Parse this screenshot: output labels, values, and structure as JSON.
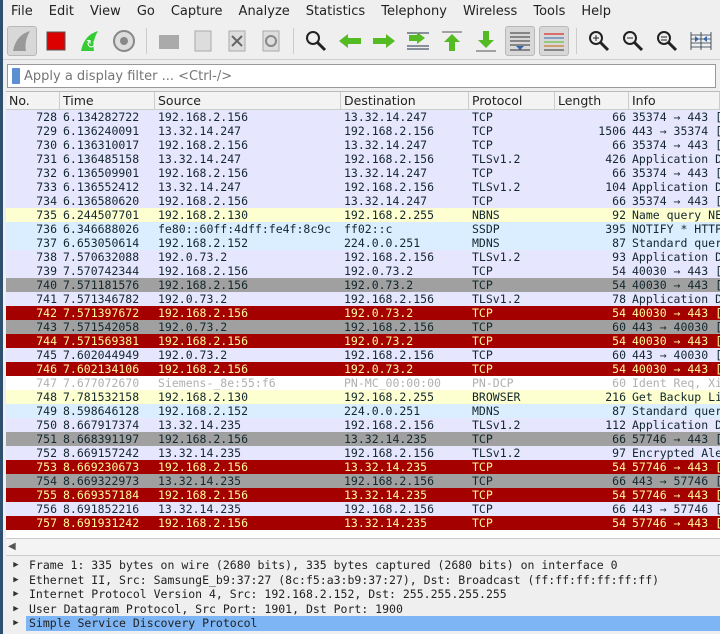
{
  "menu": [
    "File",
    "Edit",
    "View",
    "Go",
    "Capture",
    "Analyze",
    "Statistics",
    "Telephony",
    "Wireless",
    "Tools",
    "Help"
  ],
  "toolbar": [
    "start-capture",
    "stop-capture",
    "restart-capture",
    "capture-options",
    "open-file",
    "save-file",
    "close-file",
    "reload-file",
    "find-packet",
    "go-back",
    "go-forward",
    "go-to-packet",
    "go-first",
    "go-last",
    "auto-scroll",
    "colorize",
    "zoom-in",
    "zoom-out",
    "zoom-normal",
    "resize-columns"
  ],
  "filter": {
    "placeholder": "Apply a display filter ... <Ctrl-/>",
    "value": ""
  },
  "columns": [
    "No.",
    "Time",
    "Source",
    "Destination",
    "Protocol",
    "Length",
    "Info"
  ],
  "colors": {
    "tcp": "#e7e6ff",
    "bad_tcp": "#a40000",
    "bad_text": "#fffc9c",
    "grey": "#a0a0a0",
    "nbns": "#feffd0",
    "udp": "#daeeff",
    "selected": "#7eb5f5"
  },
  "packets": [
    [
      "728",
      "6.134282722",
      "192.168.2.156",
      "13.32.14.247",
      "TCP",
      "66",
      "35374 → 443 [",
      "tcp"
    ],
    [
      "729",
      "6.136240091",
      "13.32.14.247",
      "192.168.2.156",
      "TCP",
      "1506",
      "443 → 35374 [",
      "tcp"
    ],
    [
      "730",
      "6.136310017",
      "192.168.2.156",
      "13.32.14.247",
      "TCP",
      "66",
      "35374 → 443 [",
      "tcp"
    ],
    [
      "731",
      "6.136485158",
      "13.32.14.247",
      "192.168.2.156",
      "TLSv1.2",
      "426",
      "Application D",
      "tcp"
    ],
    [
      "732",
      "6.136509901",
      "192.168.2.156",
      "13.32.14.247",
      "TCP",
      "66",
      "35374 → 443 [",
      "tcp"
    ],
    [
      "733",
      "6.136552412",
      "13.32.14.247",
      "192.168.2.156",
      "TLSv1.2",
      "104",
      "Application D",
      "tcp"
    ],
    [
      "734",
      "6.136580620",
      "192.168.2.156",
      "13.32.14.247",
      "TCP",
      "66",
      "35374 → 443 [",
      "tcp"
    ],
    [
      "735",
      "6.244507701",
      "192.168.2.130",
      "192.168.2.255",
      "NBNS",
      "92",
      "Name query NE",
      "nb"
    ],
    [
      "736",
      "6.346688026",
      "fe80::60ff:4dff:fe4f:8c9c",
      "ff02::c",
      "SSDP",
      "395",
      "NOTIFY * HTTP",
      "ud"
    ],
    [
      "737",
      "6.653050614",
      "192.168.2.152",
      "224.0.0.251",
      "MDNS",
      "87",
      "Standard quer",
      "ud"
    ],
    [
      "738",
      "7.570632088",
      "192.0.73.2",
      "192.168.2.156",
      "TLSv1.2",
      "93",
      "Application D",
      "tcp"
    ],
    [
      "739",
      "7.570742344",
      "192.168.2.156",
      "192.0.73.2",
      "TCP",
      "54",
      "40030 → 443 [",
      "tcp"
    ],
    [
      "740",
      "7.571181576",
      "192.168.2.156",
      "192.0.73.2",
      "TCP",
      "54",
      "40030 → 443 [",
      "gr"
    ],
    [
      "741",
      "7.571346782",
      "192.0.73.2",
      "192.168.2.156",
      "TLSv1.2",
      "78",
      "Application D",
      "tcp"
    ],
    [
      "742",
      "7.571397672",
      "192.168.2.156",
      "192.0.73.2",
      "TCP",
      "54",
      "40030 → 443 [",
      "bad"
    ],
    [
      "743",
      "7.571542058",
      "192.0.73.2",
      "192.168.2.156",
      "TCP",
      "60",
      "443 → 40030 [",
      "gr"
    ],
    [
      "744",
      "7.571569381",
      "192.168.2.156",
      "192.0.73.2",
      "TCP",
      "54",
      "40030 → 443 [",
      "bad"
    ],
    [
      "745",
      "7.602044949",
      "192.0.73.2",
      "192.168.2.156",
      "TCP",
      "60",
      "443 → 40030 [",
      "tcp"
    ],
    [
      "746",
      "7.602134106",
      "192.168.2.156",
      "192.0.73.2",
      "TCP",
      "54",
      "40030 → 443 [",
      "bad"
    ],
    [
      "747",
      "7.677072670",
      "Siemens-_8e:55:f6",
      "PN-MC_00:00:00",
      "PN-DCP",
      "60",
      "Ident Req, Xi",
      "pn"
    ],
    [
      "748",
      "7.781532158",
      "192.168.2.130",
      "192.168.2.255",
      "BROWSER",
      "216",
      "Get Backup Li",
      "nb"
    ],
    [
      "749",
      "8.598646128",
      "192.168.2.152",
      "224.0.0.251",
      "MDNS",
      "87",
      "Standard quer",
      "ud"
    ],
    [
      "750",
      "8.667917374",
      "13.32.14.235",
      "192.168.2.156",
      "TLSv1.2",
      "112",
      "Application D",
      "tcp"
    ],
    [
      "751",
      "8.668391197",
      "192.168.2.156",
      "13.32.14.235",
      "TCP",
      "66",
      "57746 → 443 [",
      "gr"
    ],
    [
      "752",
      "8.669157242",
      "13.32.14.235",
      "192.168.2.156",
      "TLSv1.2",
      "97",
      "Encrypted Ale",
      "tcp"
    ],
    [
      "753",
      "8.669230673",
      "192.168.2.156",
      "13.32.14.235",
      "TCP",
      "54",
      "57746 → 443 [",
      "bad"
    ],
    [
      "754",
      "8.669322973",
      "13.32.14.235",
      "192.168.2.156",
      "TCP",
      "66",
      "443 → 57746 [",
      "gr"
    ],
    [
      "755",
      "8.669357184",
      "192.168.2.156",
      "13.32.14.235",
      "TCP",
      "54",
      "57746 → 443 [",
      "bad"
    ],
    [
      "756",
      "8.691852216",
      "13.32.14.235",
      "192.168.2.156",
      "TCP",
      "66",
      "443 → 57746 [",
      "tcp"
    ],
    [
      "757",
      "8.691931242",
      "192.168.2.156",
      "13.32.14.235",
      "TCP",
      "54",
      "57746 → 443 [",
      "bad"
    ]
  ],
  "details": [
    {
      "text": "Frame 1: 335 bytes on wire (2680 bits), 335 bytes captured (2680 bits) on interface 0",
      "selected": false
    },
    {
      "text": "Ethernet II, Src: SamsungE_b9:37:27 (8c:f5:a3:b9:37:27), Dst: Broadcast (ff:ff:ff:ff:ff:ff)",
      "selected": false
    },
    {
      "text": "Internet Protocol Version 4, Src: 192.168.2.152, Dst: 255.255.255.255",
      "selected": false
    },
    {
      "text": "User Datagram Protocol, Src Port: 1901, Dst Port: 1900",
      "selected": false
    },
    {
      "text": "Simple Service Discovery Protocol",
      "selected": true
    }
  ]
}
